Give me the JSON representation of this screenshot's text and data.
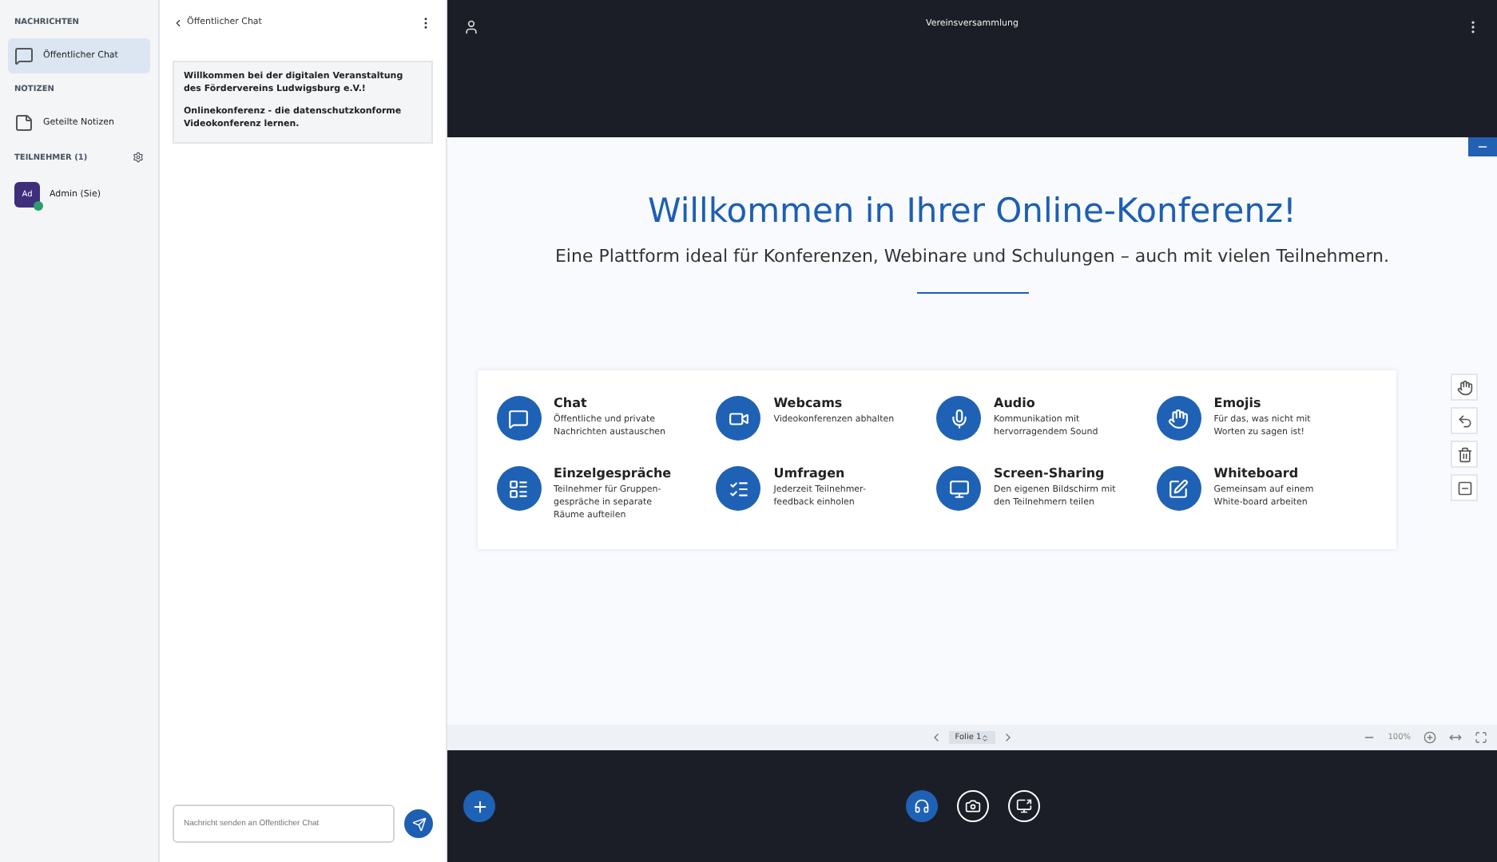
{
  "sidebar": {
    "messages_heading": "NACHRICHTEN",
    "chat_items": [
      {
        "label": "Öffentlicher Chat",
        "selected": true
      }
    ],
    "notes_heading": "NOTIZEN",
    "notes_items": [
      {
        "label": "Geteilte Notizen",
        "selected": false
      }
    ],
    "participants_heading": "TEILNEHMER (1)",
    "participants": [
      {
        "initials": "Ad",
        "name": "Admin (Sie)"
      }
    ]
  },
  "chat": {
    "title": "Öffentlicher Chat",
    "messages": [
      "Willkommen bei der digitalen Veranstaltung des Fördervereins Ludwigsburg e.V.!",
      "Onlinekonferenz - die datenschutzkonforme Videokonferenz lernen."
    ],
    "input": {
      "placeholder": "Nachricht senden an Öffentlicher Chat"
    }
  },
  "meeting": {
    "title": "Vereinsversammlung"
  },
  "slide": {
    "title": "Willkommen in Ihrer Online-Konferenz!",
    "subtitle": "Eine Plattform ideal für Konferenzen, Webinare und Schulungen – auch mit vielen Teilnehmern.",
    "features": [
      {
        "kind": "chat",
        "title": "Chat",
        "text": "Öffentliche und private Nachrichten austauschen"
      },
      {
        "kind": "webcam",
        "title": "Webcams",
        "text": "Videokonferenzen abhalten"
      },
      {
        "kind": "audio",
        "title": "Audio",
        "text": "Kommunikation mit hervorragendem Sound"
      },
      {
        "kind": "emoji",
        "title": "Emojis",
        "text": "Für das, was nicht mit Worten zu sagen ist!"
      },
      {
        "kind": "breakout",
        "title": "Einzelgespräche",
        "text": "Teilnehmer für Gruppen-gespräche in separate Räume aufteilen"
      },
      {
        "kind": "poll",
        "title": "Umfragen",
        "text": "Jederzeit Teilnehmer-feedback einholen"
      },
      {
        "kind": "screen",
        "title": "Screen-Sharing",
        "text": "Den eigenen Bildschirm mit den Teilnehmern teilen"
      },
      {
        "kind": "whiteboard",
        "title": "Whiteboard",
        "text": "Gemeinsam auf einem White-board arbeiten"
      }
    ]
  },
  "slide_toolbar": {
    "page": "Folie 1",
    "zoom": "100%"
  },
  "controls": [
    {
      "kind": "audio",
      "active": true
    },
    {
      "kind": "video",
      "active": false
    },
    {
      "kind": "screen",
      "active": false
    }
  ]
}
